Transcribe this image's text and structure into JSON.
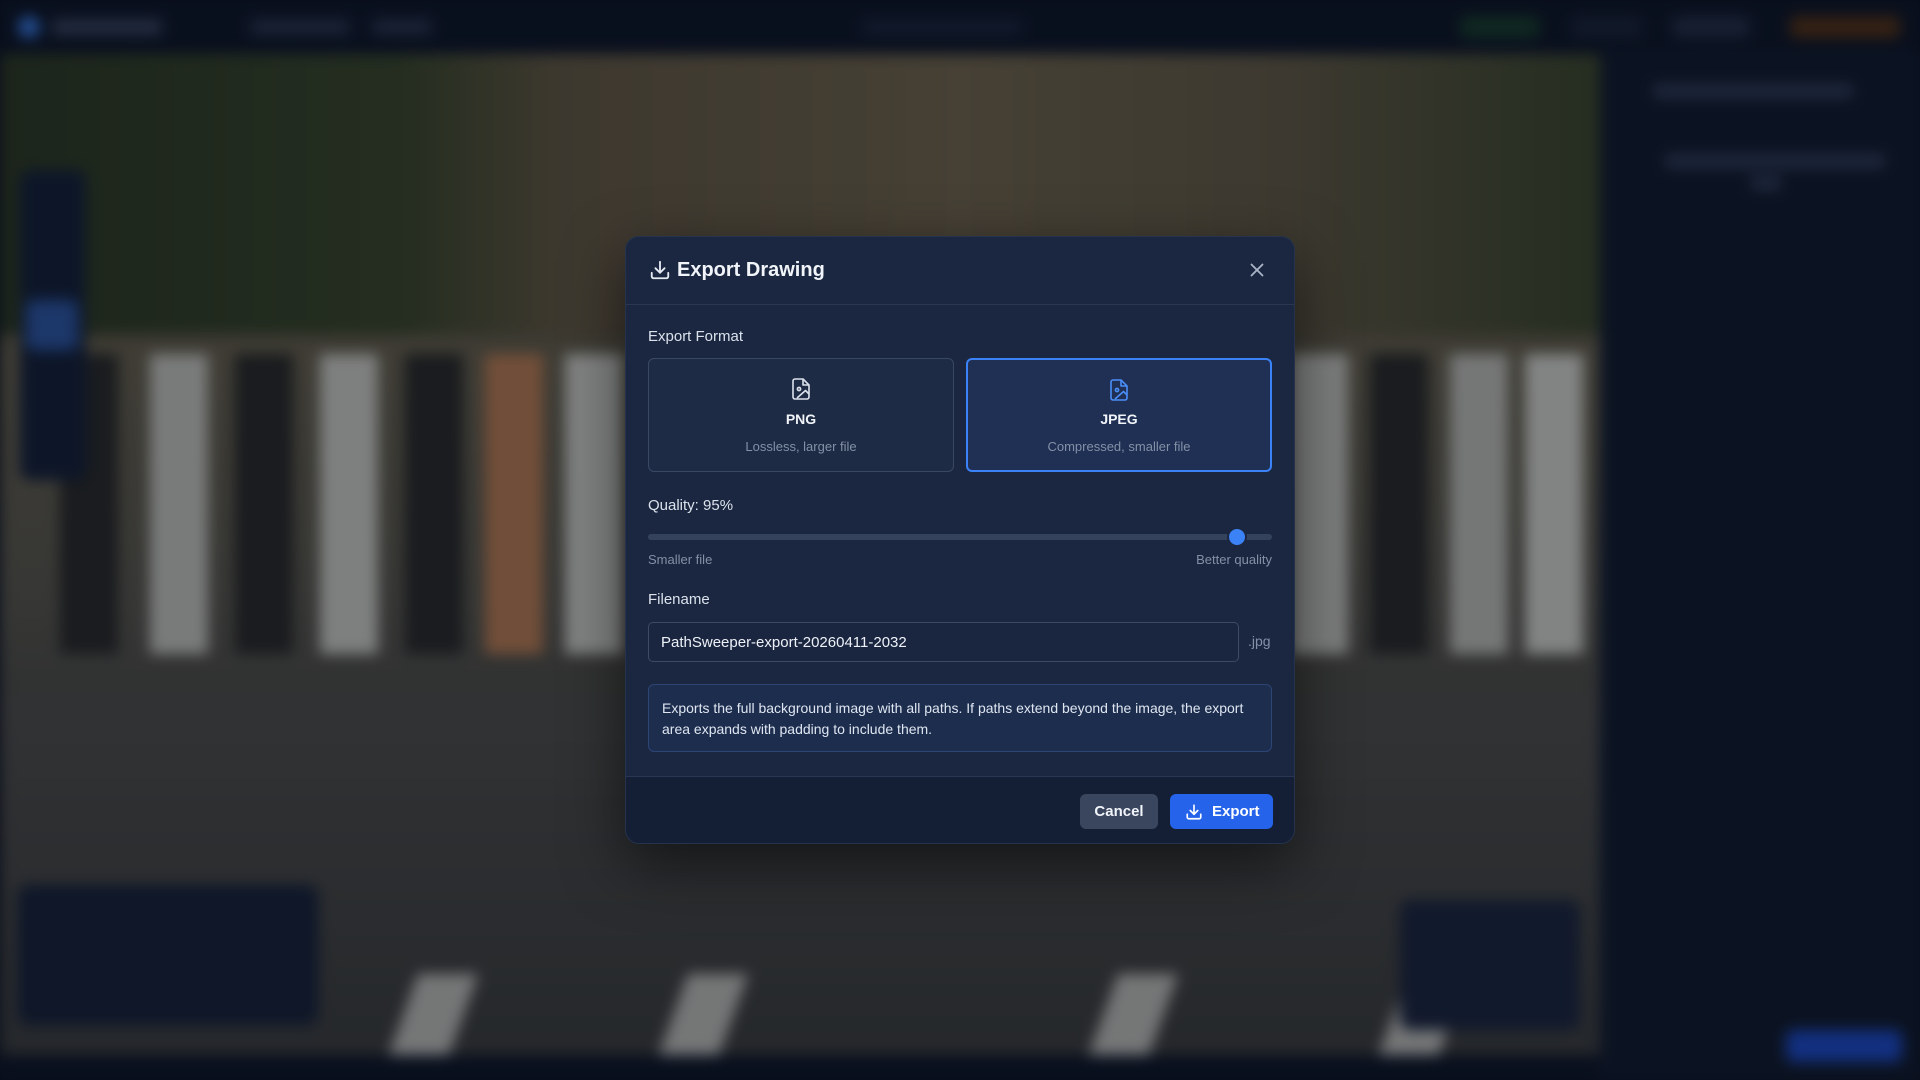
{
  "dialog": {
    "title": "Export Drawing",
    "title_icon": "download-icon",
    "close_icon": "close-icon",
    "format_label": "Export Format",
    "formats": [
      {
        "name": "PNG",
        "description": "Lossless, larger file",
        "icon": "file-image-icon",
        "selected": false
      },
      {
        "name": "JPEG",
        "description": "Compressed, smaller file",
        "icon": "file-image-icon",
        "selected": true
      }
    ],
    "quality": {
      "label": "Quality: 95%",
      "value_percent": 95,
      "min_hint": "Smaller file",
      "max_hint": "Better quality"
    },
    "filename": {
      "label": "Filename",
      "value": "PathSweeper-export-20260411-2032",
      "extension": ".jpg"
    },
    "info_text": "Exports the full background image with all paths. If paths extend beyond the image, the export area expands with padding to include them.",
    "buttons": {
      "cancel": "Cancel",
      "export": "Export"
    }
  },
  "colors": {
    "accent": "#3b82f6",
    "primary_button": "#2563eb",
    "dialog_bg": "#1b2740",
    "footer_bg": "#141f35"
  }
}
